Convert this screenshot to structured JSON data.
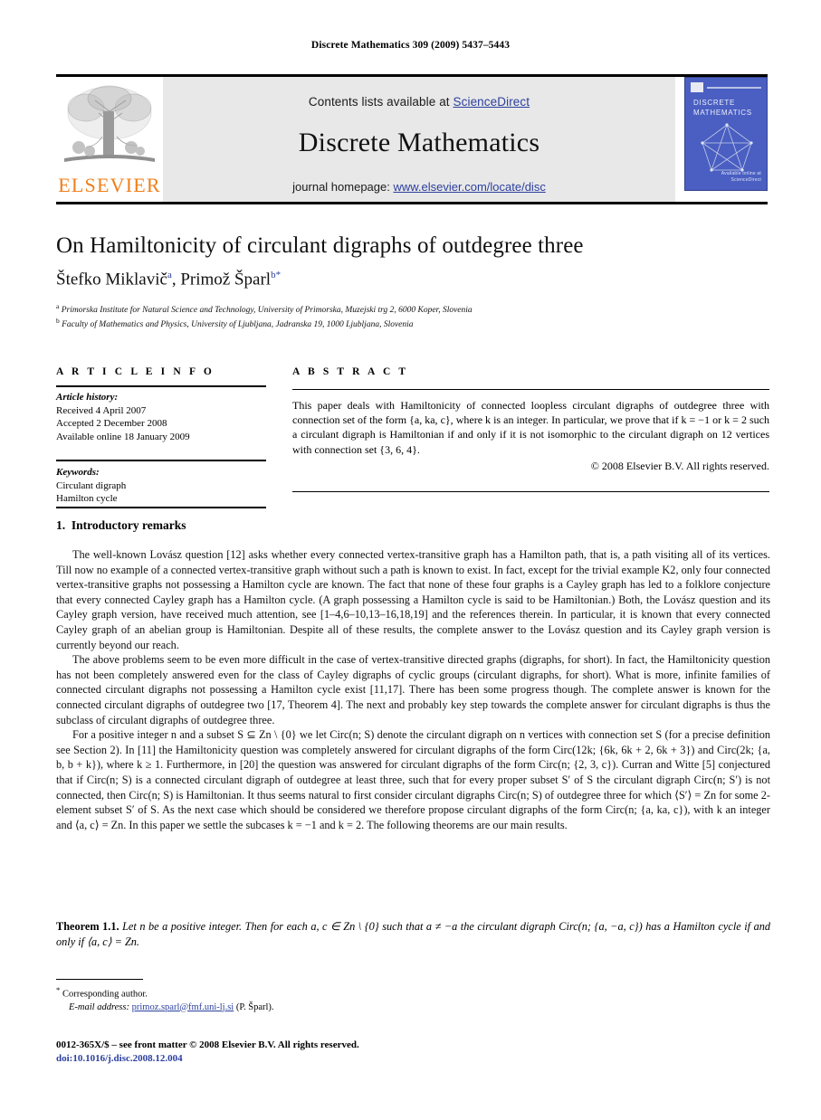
{
  "running_head": "Discrete Mathematics 309 (2009) 5437–5443",
  "masthead": {
    "contents_prefix": "Contents lists available at ",
    "sciencedirect": "ScienceDirect",
    "journal_title": "Discrete Mathematics",
    "homepage_prefix": "journal homepage: ",
    "homepage_url": "www.elsevier.com/locate/disc",
    "publisher_wordmark": "ELSEVIER",
    "publisher_color": "#f07f1a",
    "link_color": "#2b3f9e",
    "band_color": "#e8e8e8",
    "cover": {
      "title_line1": "DISCRETE",
      "title_line2": "MATHEMATICS",
      "footer_line1": "Available online at",
      "footer_line2": "ScienceDirect",
      "bg_color": "#4a5fc1"
    }
  },
  "title": "On Hamiltonicity of circulant digraphs of outdegree three",
  "authors": {
    "a1_name": "Štefko Miklavič",
    "a1_sup": "a",
    "separator": ", ",
    "a2_name": "Primož Šparl",
    "a2_sup": "b",
    "a2_star": "*"
  },
  "affiliations": [
    {
      "sup": "a",
      "text": "Primorska Institute for Natural Science and Technology, University of Primorska, Muzejski trg 2, 6000 Koper, Slovenia"
    },
    {
      "sup": "b",
      "text": "Faculty of Mathematics and Physics, University of Ljubljana, Jadranska 19, 1000 Ljubljana, Slovenia"
    }
  ],
  "article_info": {
    "heading": "A R T I C L E    I N F O",
    "history_label": "Article history:",
    "received": "Received 4 April 2007",
    "accepted": "Accepted 2 December 2008",
    "available": "Available online 18 January 2009",
    "keywords_label": "Keywords:",
    "keywords": [
      "Circulant digraph",
      "Hamilton cycle"
    ]
  },
  "abstract": {
    "heading": "A B S T R A C T",
    "text": "This paper deals with Hamiltonicity of connected loopless circulant digraphs of outdegree three with connection set of the form {a, ka, c}, where k is an integer. In particular, we prove that if k = −1 or k = 2 such a circulant digraph is Hamiltonian if and only if it is not isomorphic to the circulant digraph on 12 vertices with connection set {3, 6, 4}.",
    "copyright": "© 2008 Elsevier B.V. All rights reserved."
  },
  "section": {
    "number": "1.",
    "heading": "Introductory remarks"
  },
  "paragraphs": [
    "The well-known Lovász question [12] asks whether every connected vertex-transitive graph has a Hamilton path, that is, a path visiting all of its vertices. Till now no example of a connected vertex-transitive graph without such a path is known to exist. In fact, except for the trivial example K2, only four connected vertex-transitive graphs not possessing a Hamilton cycle are known. The fact that none of these four graphs is a Cayley graph has led to a folklore conjecture that every connected Cayley graph has a Hamilton cycle. (A graph possessing a Hamilton cycle is said to be Hamiltonian.) Both, the Lovász question and its Cayley graph version, have received much attention, see [1–4,6–10,13–16,18,19] and the references therein. In particular, it is known that every connected Cayley graph of an abelian group is Hamiltonian. Despite all of these results, the complete answer to the Lovász question and its Cayley graph version is currently beyond our reach.",
    "The above problems seem to be even more difficult in the case of vertex-transitive directed graphs (digraphs, for short). In fact, the Hamiltonicity question has not been completely answered even for the class of Cayley digraphs of cyclic groups (circulant digraphs, for short). What is more, infinite families of connected circulant digraphs not possessing a Hamilton cycle exist [11,17]. There has been some progress though. The complete answer is known for the connected circulant digraphs of outdegree two [17, Theorem 4]. The next and probably key step towards the complete answer for circulant digraphs is thus the subclass of circulant digraphs of outdegree three.",
    "For a positive integer n and a subset S ⊆ Zn \\ {0} we let Circ(n; S) denote the circulant digraph on n vertices with connection set S (for a precise definition see Section 2). In [11] the Hamiltonicity question was completely answered for circulant digraphs of the form Circ(12k; {6k, 6k + 2, 6k + 3}) and Circ(2k; {a, b, b + k}), where k ≥ 1. Furthermore, in [20] the question was answered for circulant digraphs of the form Circ(n; {2, 3, c}). Curran and Witte [5] conjectured that if Circ(n; S) is a connected circulant digraph of outdegree at least three, such that for every proper subset S′ of S the circulant digraph Circ(n; S′) is not connected, then Circ(n; S) is Hamiltonian. It thus seems natural to first consider circulant digraphs Circ(n; S) of outdegree three for which ⟨S′⟩ = Zn for some 2-element subset S′ of S. As the next case which should be considered we therefore propose circulant digraphs of the form Circ(n; {a, ka, c}), with k an integer and ⟨a, c⟩ = Zn. In this paper we settle the subcases k = −1 and k = 2. The following theorems are our main results."
  ],
  "theorem": {
    "label": "Theorem 1.1.",
    "text": "Let n be a positive integer. Then for each a, c ∈ Zn \\ {0} such that a ≠ −a the circulant digraph Circ(n; {a, −a, c}) has a Hamilton cycle if and only if ⟨a, c⟩ = Zn."
  },
  "footnotes": {
    "corresponding_marker": "*",
    "corresponding_text": "Corresponding author.",
    "email_label": "E-mail address:",
    "email": "primoz.sparl@fmf.uni-lj.si",
    "email_owner": "(P. Šparl)."
  },
  "frontmatter": {
    "line1": "0012-365X/$ – see front matter © 2008 Elsevier B.V. All rights reserved.",
    "doi": "doi:10.1016/j.disc.2008.12.004"
  }
}
